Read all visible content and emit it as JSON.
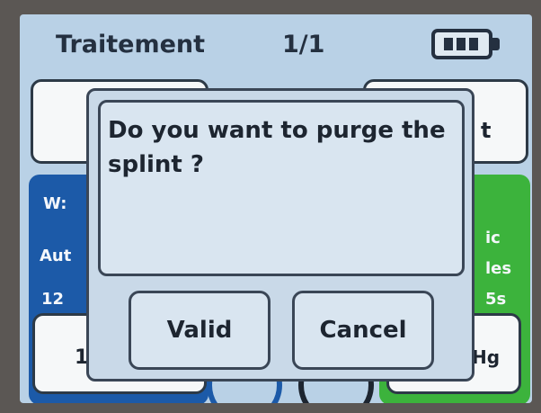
{
  "header": {
    "title": "Traitement",
    "page_indicator": "1/1",
    "battery_icon": "battery-icon"
  },
  "background": {
    "left_box_fragment": "W:",
    "left_mode_fragment": "Aut",
    "left_value_fragment": "12",
    "left_bottom_fragment": "1",
    "right_top_fragment": "t",
    "right_mode_fragment_1": "ic",
    "right_mode_fragment_2": "les",
    "right_mode_fragment_3": "5s",
    "right_bottom_fragment": "Hg",
    "colors": {
      "blue_panel": "#1c5aa8",
      "green_panel": "#3cb33c"
    }
  },
  "dialog": {
    "message": "Do you want to purge the splint ?",
    "valid_label": "Valid",
    "cancel_label": "Cancel"
  }
}
